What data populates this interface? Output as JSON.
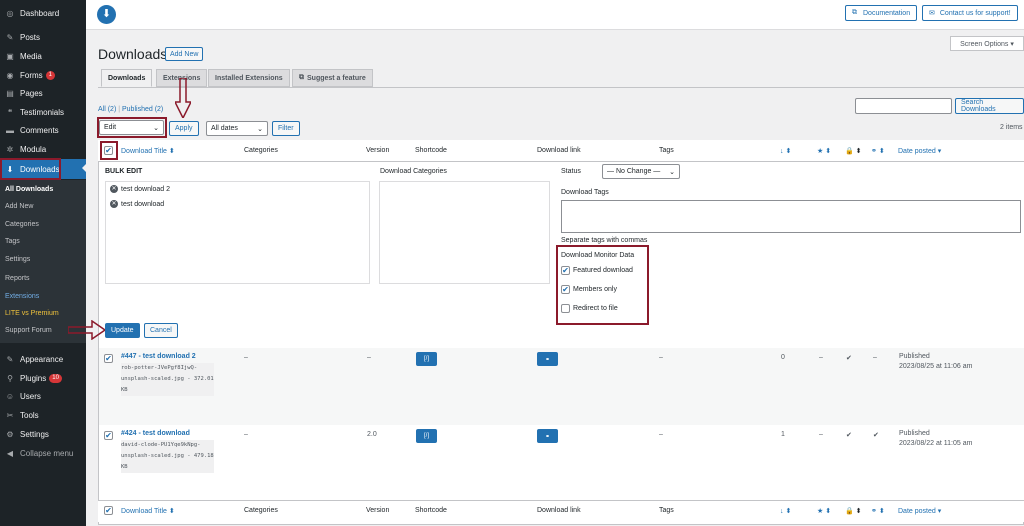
{
  "sidebar": {
    "items": [
      {
        "label": "Dashboard",
        "icon": "dashboard-icon",
        "glyph": "◎"
      },
      {
        "label": "Posts",
        "icon": "pin-icon",
        "glyph": "✎"
      },
      {
        "label": "Media",
        "icon": "media-icon",
        "glyph": "▣"
      },
      {
        "label": "Forms",
        "icon": "forms-icon",
        "glyph": "◉",
        "badge": "1"
      },
      {
        "label": "Pages",
        "icon": "pages-icon",
        "glyph": "▤"
      },
      {
        "label": "Testimonials",
        "icon": "testimonials-icon",
        "glyph": "❝"
      },
      {
        "label": "Comments",
        "icon": "comments-icon",
        "glyph": "▬"
      },
      {
        "label": "Modula",
        "icon": "modula-icon",
        "glyph": "✲"
      },
      {
        "label": "Downloads",
        "icon": "download-icon",
        "glyph": "⬇"
      }
    ],
    "subitems": [
      "All Downloads",
      "Add New",
      "Categories",
      "Tags",
      "Settings",
      "Reports",
      "Extensions",
      "LITE vs Premium",
      "Support Forum"
    ],
    "lower_items": [
      {
        "label": "Appearance",
        "icon": "appearance-icon",
        "glyph": "✎"
      },
      {
        "label": "Plugins",
        "icon": "plugins-icon",
        "glyph": "⚲",
        "badge": "10"
      },
      {
        "label": "Users",
        "icon": "users-icon",
        "glyph": "☺"
      },
      {
        "label": "Tools",
        "icon": "tools-icon",
        "glyph": "✂"
      },
      {
        "label": "Settings",
        "icon": "settings-icon",
        "glyph": "⚙"
      },
      {
        "label": "Collapse menu",
        "icon": "collapse-icon",
        "glyph": "◀"
      }
    ]
  },
  "topbar": {
    "documentation": "Documentation",
    "support": "Contact us for support!",
    "logo_glyph": "⬇"
  },
  "screen_options": "Screen Options ▾",
  "page": {
    "title": "Downloads",
    "add_new": "Add New"
  },
  "tabs": [
    "Downloads",
    "Extensions",
    "Installed Extensions",
    "Suggest a feature"
  ],
  "views": {
    "all": "All (2)",
    "sep": " | ",
    "published": "Published (2)"
  },
  "filters": {
    "bulk_action": "Edit",
    "apply": "Apply",
    "dates": "All dates",
    "filter": "Filter",
    "search_button": "Search Downloads",
    "items_count": "2 items"
  },
  "columns": [
    "Download Title",
    "Categories",
    "Version",
    "Shortcode",
    "Download link",
    "Tags",
    "Date posted"
  ],
  "sort_glyph": "⬍",
  "bulk_edit": {
    "heading": "BULK EDIT",
    "titles": [
      "test download 2",
      "test download"
    ],
    "categories_label": "Download Categories",
    "status_label": "Status",
    "status_value": "— No Change —",
    "tags_label": "Download Tags",
    "tags_hint": "Separate tags with commas",
    "dm_label": "Download Monitor Data",
    "featured": "Featured download",
    "members": "Members only",
    "redirect": "Redirect to file",
    "update": "Update",
    "cancel": "Cancel"
  },
  "rows": [
    {
      "title": "#447 - test download 2",
      "file_lines": [
        "rob-potter-JVePgf8IjwQ-",
        "unsplash-scaled.jpg - 372.01",
        "KB"
      ],
      "categories": "–",
      "version": "–",
      "tags": "–",
      "count": "0",
      "featured": "–",
      "members": "✔",
      "redirect": "–",
      "status": "Published",
      "date": "2023/08/25 at 11:06 am",
      "shortcode_glyph": "[/]",
      "link_glyph": "🔗"
    },
    {
      "title": "#424 - test download",
      "file_lines": [
        "david-clode-PU1Yqe9kNpg-",
        "unsplash-scaled.jpg - 479.18",
        "KB"
      ],
      "categories": "–",
      "version": "2.0",
      "tags": "–",
      "count": "1",
      "featured": "–",
      "members": "✔",
      "redirect": "✔",
      "status": "Published",
      "date": "2023/08/22 at 11:05 am",
      "shortcode_glyph": "[/]",
      "link_glyph": "🔗"
    }
  ]
}
